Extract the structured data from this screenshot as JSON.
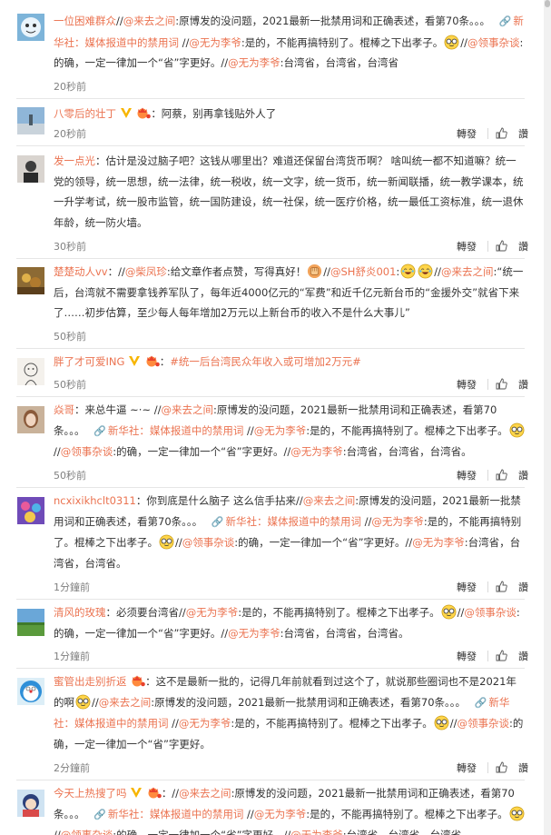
{
  "actions": {
    "repost_label": "轉發",
    "reply_label": "讚"
  },
  "colors": {
    "link": "#eb7350",
    "text": "#333333",
    "time": "#808080"
  },
  "comments": [
    {
      "username": "一位困难群众",
      "body": ":",
      "parts": [
        {
          "t": "t",
          "v": "//"
        },
        {
          "t": "m",
          "v": "@来去之间"
        },
        {
          "t": "t",
          "v": ":原博发的没问题，2021最新一批禁用词和正确表述，看第70条。。。 "
        },
        {
          "t": "l",
          "v": "新华社：媒体报道中的禁用词"
        },
        {
          "t": "t",
          "v": " //"
        },
        {
          "t": "m",
          "v": "@无为李爷"
        },
        {
          "t": "t",
          "v": ":是的，不能再搞特别了。棍棒之下出孝子。"
        },
        {
          "t": "e",
          "v": "glasses"
        },
        {
          "t": "t",
          "v": "//"
        },
        {
          "t": "m",
          "v": "@领事杂谈"
        },
        {
          "t": "t",
          "v": ":的确，一定一律加一个“省”字更好。//"
        },
        {
          "t": "m",
          "v": "@无为李爷"
        },
        {
          "t": "t",
          "v": ":台湾省，台湾省，台湾省"
        }
      ],
      "time": "20秒前",
      "show_actions": false
    },
    {
      "username": "八零后的壮丁",
      "parts": [
        {
          "t": "t",
          "v": "：阿蔡，别再拿钱贴外人了"
        }
      ],
      "time": "20秒前",
      "show_actions": true
    },
    {
      "username": "发一点光",
      "parts": [
        {
          "t": "t",
          "v": "：估计是没过脑子吧？这钱从哪里出？难道还保留台湾货币啊？ 啥叫统一都不知道嘛？统一党的领导，统一思想，统一法律，统一税收，统一文字，统一货币，统一新闻联播，统一教学课本，统一升学考试，统一股市监管，统一国防建设，统一社保，统一医疗价格，统一最低工资标准，统一退休年龄，统一防火墙。"
        }
      ],
      "time": "30秒前",
      "show_actions": true
    },
    {
      "username": "楚楚动人vv",
      "parts": [
        {
          "t": "t",
          "v": "：//"
        },
        {
          "t": "m",
          "v": "@柴凤珍"
        },
        {
          "t": "t",
          "v": ":给文章作者点赞，写得真好！"
        },
        {
          "t": "e",
          "v": "fist"
        },
        {
          "t": "t",
          "v": "//"
        },
        {
          "t": "m",
          "v": "@SH舒炎001"
        },
        {
          "t": "t",
          "v": ":"
        },
        {
          "t": "e",
          "v": "laugh"
        },
        {
          "t": "e",
          "v": "laugh"
        },
        {
          "t": "t",
          "v": "//"
        },
        {
          "t": "m",
          "v": "@来去之间"
        },
        {
          "t": "t",
          "v": ":“统一后，台湾就不需要拿钱养军队了，每年近4000亿元的“军费”和近千亿元新台币的“金援外交”就省下来了……初步估算，至少每人每年增加2万元以上新台币的收入不是什么大事儿”"
        }
      ],
      "time": "50秒前",
      "show_actions": false
    },
    {
      "username": "胖了才可爱ING",
      "parts": [
        {
          "t": "t",
          "v": "："
        },
        {
          "t": "m",
          "v": "#统一后台湾民众年收入或可增加2万元#"
        }
      ],
      "time": "50秒前",
      "show_actions": true
    },
    {
      "username": "焱哥",
      "parts": [
        {
          "t": "t",
          "v": "：来总牛逼 ~·~ //"
        },
        {
          "t": "m",
          "v": "@来去之间"
        },
        {
          "t": "t",
          "v": ":原博发的没问题，2021最新一批禁用词和正确表述，看第70条。。。 "
        },
        {
          "t": "l",
          "v": "新华社：媒体报道中的禁用词"
        },
        {
          "t": "t",
          "v": " //"
        },
        {
          "t": "m",
          "v": "@无为李爷"
        },
        {
          "t": "t",
          "v": ":是的，不能再搞特别了。棍棒之下出孝子。"
        },
        {
          "t": "e",
          "v": "glasses"
        },
        {
          "t": "t",
          "v": "//"
        },
        {
          "t": "m",
          "v": "@领事杂谈"
        },
        {
          "t": "t",
          "v": ":的确，一定一律加一个“省”字更好。//"
        },
        {
          "t": "m",
          "v": "@无为李爷"
        },
        {
          "t": "t",
          "v": ":台湾省，台湾省，台湾省。"
        }
      ],
      "time": "50秒前",
      "show_actions": true
    },
    {
      "username": "ncxixikhclt0311",
      "parts": [
        {
          "t": "t",
          "v": "：你到底是什么脑子 这么信手拈来//"
        },
        {
          "t": "m",
          "v": "@来去之间"
        },
        {
          "t": "t",
          "v": ":原博发的没问题，2021最新一批禁用词和正确表述，看第70条。。。 "
        },
        {
          "t": "l",
          "v": "新华社：媒体报道中的禁用词"
        },
        {
          "t": "t",
          "v": " //"
        },
        {
          "t": "m",
          "v": "@无为李爷"
        },
        {
          "t": "t",
          "v": ":是的，不能再搞特别了。棍棒之下出孝子。"
        },
        {
          "t": "e",
          "v": "glasses"
        },
        {
          "t": "t",
          "v": "//"
        },
        {
          "t": "m",
          "v": "@领事杂谈"
        },
        {
          "t": "t",
          "v": ":的确，一定一律加一个“省”字更好。//"
        },
        {
          "t": "m",
          "v": "@无为李爷"
        },
        {
          "t": "t",
          "v": ":台湾省，台湾省，台湾省。"
        }
      ],
      "time": "1分鐘前",
      "show_actions": true
    },
    {
      "username": "清风的玫瑰",
      "parts": [
        {
          "t": "t",
          "v": "：必须要台湾省//"
        },
        {
          "t": "m",
          "v": "@无为李爷"
        },
        {
          "t": "t",
          "v": ":是的，不能再搞特别了。棍棒之下出孝子。"
        },
        {
          "t": "e",
          "v": "glasses"
        },
        {
          "t": "t",
          "v": "//"
        },
        {
          "t": "m",
          "v": "@领事杂谈"
        },
        {
          "t": "t",
          "v": ":的确，一定一律加一个“省”字更好。//"
        },
        {
          "t": "m",
          "v": "@无为李爷"
        },
        {
          "t": "t",
          "v": ":台湾省，台湾省，台湾省。"
        }
      ],
      "time": "1分鐘前",
      "show_actions": true
    },
    {
      "username": "蜜管出走别折返",
      "parts": [
        {
          "t": "t",
          "v": "：这不是最新一批的，记得几年前就看到过这个了，就说那些圈词也不是2021年的啊"
        },
        {
          "t": "e",
          "v": "glasses"
        },
        {
          "t": "t",
          "v": "//"
        },
        {
          "t": "m",
          "v": "@来去之间"
        },
        {
          "t": "t",
          "v": ":原博发的没问题，2021最新一批禁用词和正确表述，看第70条。。。 "
        },
        {
          "t": "l",
          "v": "新华社：媒体报道中的禁用词"
        },
        {
          "t": "t",
          "v": " //"
        },
        {
          "t": "m",
          "v": "@无为李爷"
        },
        {
          "t": "t",
          "v": ":是的，不能再搞特别了。棍棒之下出孝子。"
        },
        {
          "t": "e",
          "v": "glasses"
        },
        {
          "t": "t",
          "v": "//"
        },
        {
          "t": "m",
          "v": "@领事杂谈"
        },
        {
          "t": "t",
          "v": ":的确，一定一律加一个“省”字更好。"
        }
      ],
      "time": "2分鐘前",
      "show_actions": true
    },
    {
      "username": "今天上热搜了吗",
      "parts": [
        {
          "t": "t",
          "v": "：//"
        },
        {
          "t": "m",
          "v": "@来去之间"
        },
        {
          "t": "t",
          "v": ":原博发的没问题，2021最新一批禁用词和正确表述，看第70条。。。 "
        },
        {
          "t": "l",
          "v": "新华社：媒体报道中的禁用词"
        },
        {
          "t": "t",
          "v": " //"
        },
        {
          "t": "m",
          "v": "@无为李爷"
        },
        {
          "t": "t",
          "v": ":是的，不能再搞特别了。棍棒之下出孝子。"
        },
        {
          "t": "e",
          "v": "glasses"
        },
        {
          "t": "t",
          "v": "//"
        },
        {
          "t": "m",
          "v": "@领事杂谈"
        },
        {
          "t": "t",
          "v": ":的确，一定一律加一个“省”字更好。//"
        },
        {
          "t": "m",
          "v": "@无为李爷"
        },
        {
          "t": "t",
          "v": ":台湾省，台湾省，台湾省"
        }
      ],
      "time": "",
      "show_actions": false
    }
  ]
}
